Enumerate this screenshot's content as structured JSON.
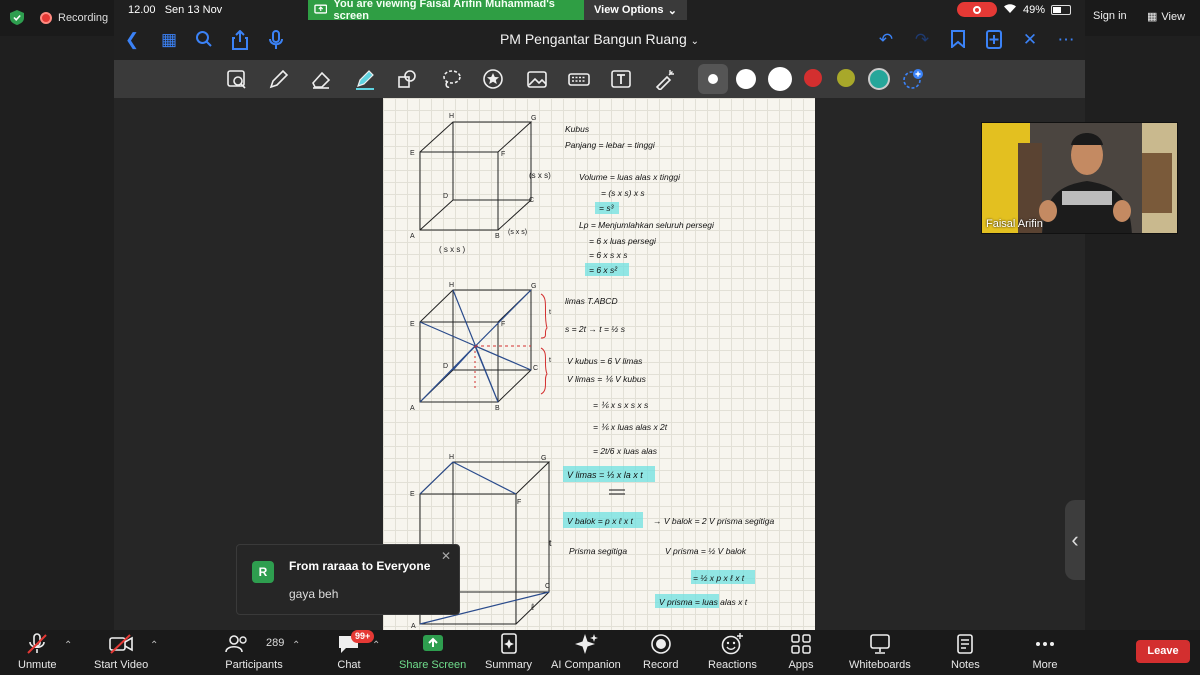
{
  "zoom_top": {
    "recording_label": "Recording",
    "banner_text": "You are viewing Faisal Arifin Muhammad's screen",
    "view_options": "View Options",
    "sign_in": "Sign in",
    "view": "View"
  },
  "ipad_status": {
    "time": "12.00",
    "date": "Sen 13 Nov",
    "battery": "49%"
  },
  "document": {
    "title": "PM Pengantar Bangun Ruang"
  },
  "pen_colors": [
    "#ffffff",
    "#ffffff",
    "#ffffff",
    "#d32f2f",
    "#a8a82a",
    "#26a69a"
  ],
  "notes": {
    "s1": {
      "heading": "Kubus",
      "l1": "Panjang = lebar = tinggi",
      "l2": "Volume = luas alas x tinggi",
      "l3": "= (s x s) x s",
      "l4": "= s³",
      "l5": "Lp = Menjumlahkan seluruh persegi",
      "l6": "= 6 x luas persegi",
      "l7": "= 6 x s x s",
      "l8": "= 6 x s²",
      "side1": "(s x s)",
      "side2": "(s x s)",
      "side3": "( s x s )"
    },
    "s2": {
      "l1": "limas T.ABCD",
      "l2": "s = 2t → t = ½ s",
      "l3": "V kubus = 6 V limas",
      "l4": "V limas = ⅙ V kubus",
      "l5": "= ⅙ x s x s x s",
      "l6": "= ⅙ x luas alas x 2t",
      "l7": "= 2t/6 x luas alas",
      "l8": "V limas = ⅓ x la x t"
    },
    "s3": {
      "l1": "V balok = p x ℓ x t",
      "l2": "→ V balok = 2 V prisma segitiga",
      "l3": "Prisma segitiga",
      "l4": "V prisma = ½ V balok",
      "l5": "= ½ x p x ℓ x t",
      "l6": "V prisma = luas alas x t",
      "t": "t",
      "l": "ℓ"
    }
  },
  "video": {
    "name": "Faisal Arifin"
  },
  "chat_toast": {
    "avatar": "R",
    "from": "From raraaa to Everyone",
    "message": "gaya beh"
  },
  "controls": {
    "unmute": "Unmute",
    "start_video": "Start Video",
    "participants": "Participants",
    "participants_count": "289",
    "chat": "Chat",
    "chat_badge": "99+",
    "share_screen": "Share Screen",
    "summary": "Summary",
    "ai_companion": "AI Companion",
    "record": "Record",
    "reactions": "Reactions",
    "apps": "Apps",
    "whiteboards": "Whiteboards",
    "notes": "Notes",
    "more": "More",
    "leave": "Leave"
  }
}
